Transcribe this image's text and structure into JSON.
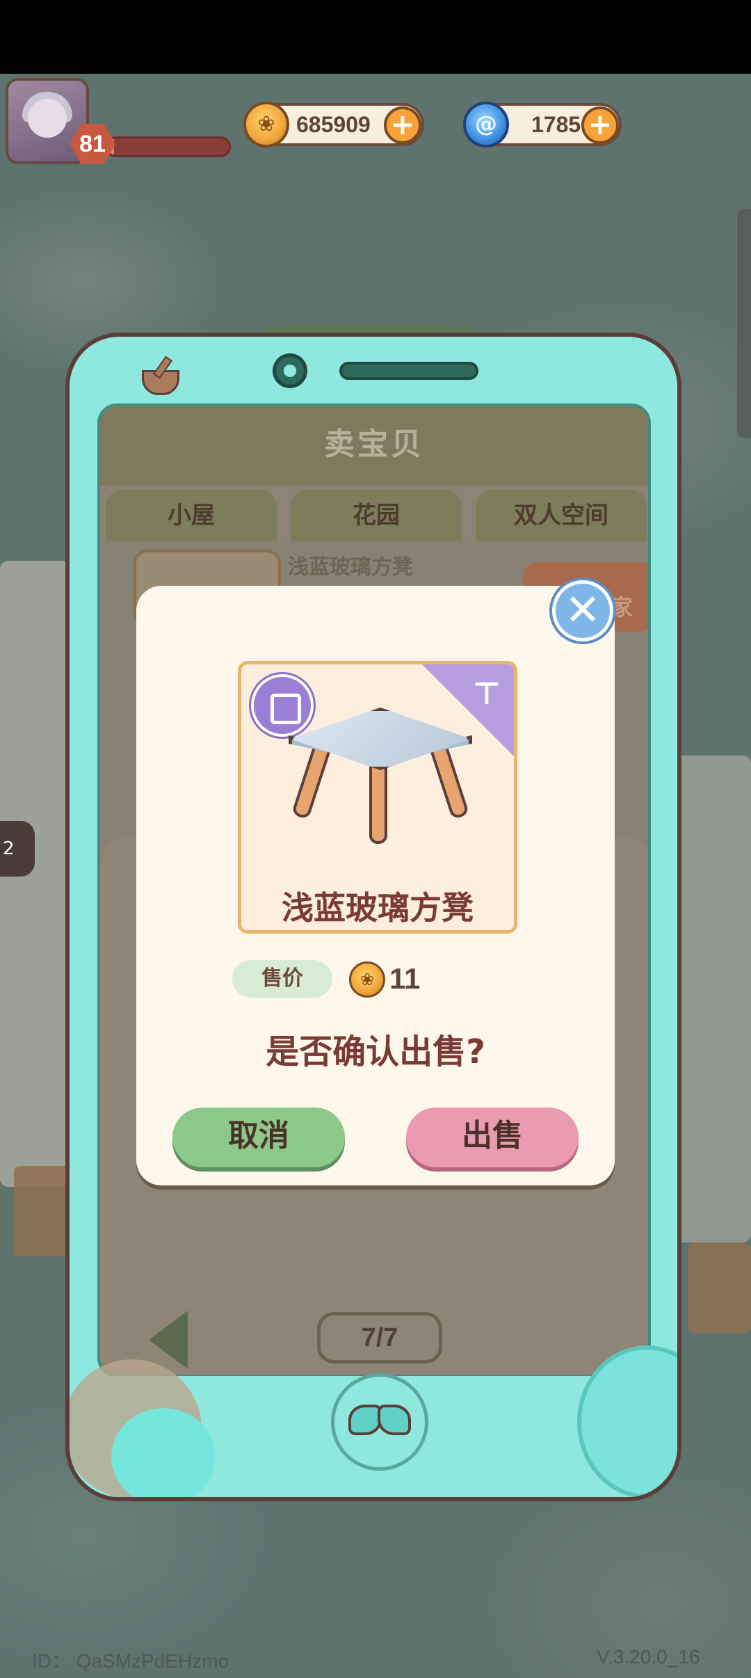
{
  "hud": {
    "level": "81",
    "xp_fraction": 0.05,
    "coins": "685909",
    "gems": "1785"
  },
  "shop": {
    "title": "卖宝贝",
    "tabs": [
      "小屋",
      "花园",
      "双人空间"
    ],
    "background_item_name": "浅蓝玻璃方凳",
    "call_buyer_label": "呼唤买家",
    "page_indicator": "7/7",
    "side_tab_label": "2"
  },
  "dialog": {
    "item_name": "浅蓝玻璃方凳",
    "price_label": "售价",
    "price_value": "11",
    "confirm_text": "是否确认出售?",
    "cancel_label": "取消",
    "sell_label": "出售"
  },
  "footer": {
    "id_text": "ID： QaSMzPdEHzmo",
    "version": "V.3.20.0_16"
  },
  "icons": {
    "coin": "coin-icon",
    "gem": "swirl-gem-icon",
    "close": "close-icon",
    "item_type": "furniture-type-icon",
    "paint": "paint-roller-icon",
    "home": "bow-icon"
  },
  "colors": {
    "phone_frame": "#8fe8de",
    "dialog_bg": "#fdf7ec",
    "cancel_button": "#8cc98a",
    "sell_button": "#ea9bb2",
    "text_accent": "#7a3b34"
  }
}
